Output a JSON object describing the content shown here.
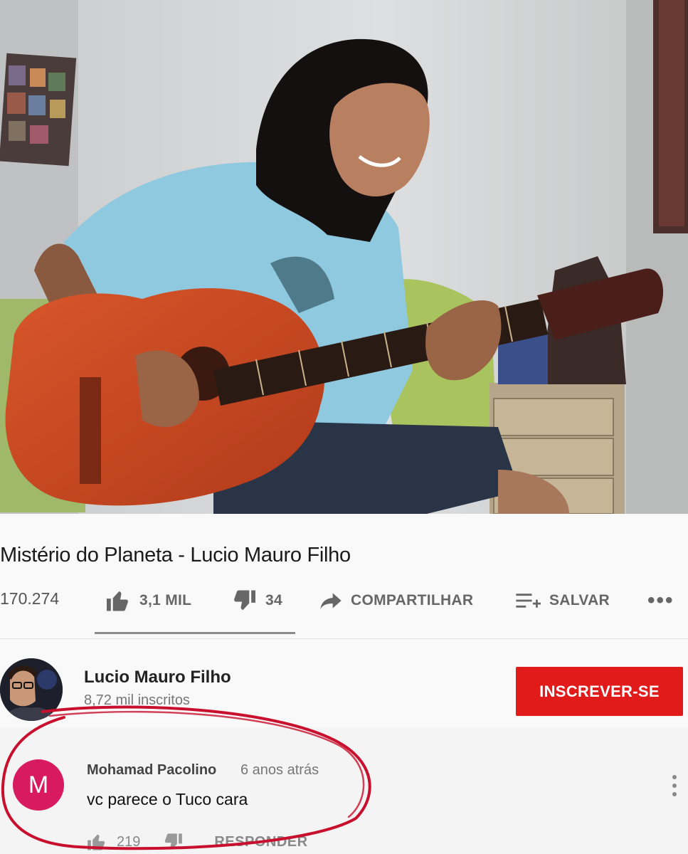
{
  "video": {
    "description_icon": "video-frame-person-playing-guitar"
  },
  "title": "Mistério do Planeta - Lucio Mauro Filho",
  "stats": {
    "views": "170.274",
    "likes": "3,1 MIL",
    "dislikes": "34",
    "share_label": "COMPARTILHAR",
    "save_label": "SALVAR",
    "more_label": "•••"
  },
  "channel": {
    "name": "Lucio Mauro Filho",
    "subscribers": "8,72 mil inscritos",
    "subscribe_label": "INSCREVER-SE"
  },
  "comment": {
    "avatar_letter": "M",
    "author": "Mohamad Pacolino",
    "time": "6 anos atrás",
    "text": "vc parece o Tuco cara",
    "likes": "219",
    "reply_label": "RESPONDER"
  },
  "colors": {
    "subscribe": "#e11a1a",
    "comment_avatar": "#d81b60",
    "annotation_circle": "#c8102e"
  }
}
